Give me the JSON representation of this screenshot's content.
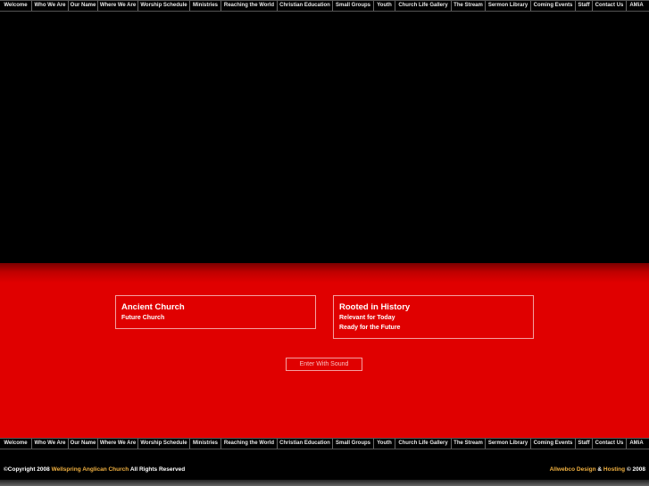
{
  "nav": {
    "items": [
      "Welcome",
      "Who We Are",
      "Our Name",
      "Where We Are",
      "Worship Schedule",
      "Ministries",
      "Reaching the World",
      "Christian Education",
      "Small Groups",
      "Youth",
      "Church Life Gallery",
      "The Stream",
      "Sermon Library",
      "Coming Events",
      "Staff",
      "Contact Us",
      "AMiA"
    ]
  },
  "box_left": {
    "title": "Ancient Church",
    "line1": "Future Church"
  },
  "box_right": {
    "title": "Rooted in History",
    "line1": "Relevant for Today",
    "line2": "Ready for the Future"
  },
  "enter_label": "Enter With Sound",
  "footer": {
    "copyright_prefix": "©Copyright 2008",
    "church_name": "Wellspring Anglican Church",
    "rights": "All Rights Reserved",
    "designer": "Allwebco Design",
    "amp": "&",
    "hosting": "Hosting",
    "year_suffix": "© 2008"
  },
  "colors": {
    "red": "#e00000",
    "gold": "#f0b040"
  }
}
